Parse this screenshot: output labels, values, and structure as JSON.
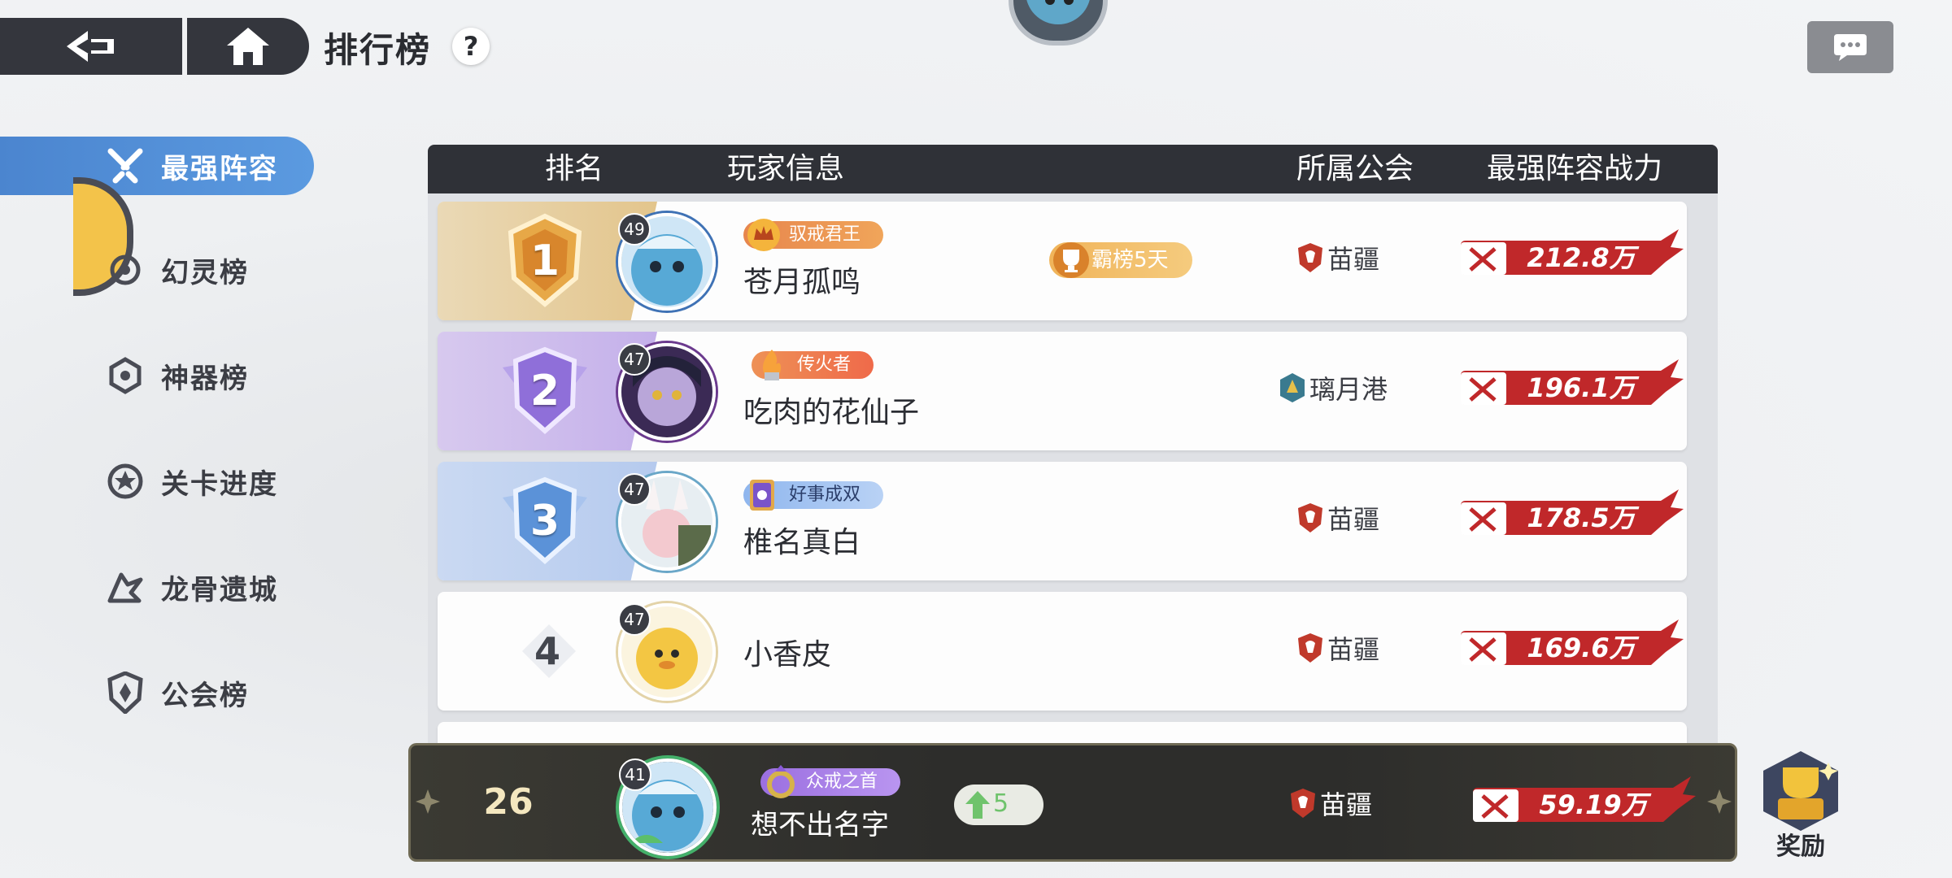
{
  "header": {
    "title": "排行榜",
    "help_label": "?"
  },
  "sidebar": {
    "items": [
      {
        "label": "最强阵容",
        "icon": "crossed-swords-icon",
        "active": true
      },
      {
        "label": "幻灵榜",
        "icon": "spirit-icon",
        "active": false
      },
      {
        "label": "神器榜",
        "icon": "artifact-icon",
        "active": false
      },
      {
        "label": "关卡进度",
        "icon": "star-badge-icon",
        "active": false
      },
      {
        "label": "龙骨遗城",
        "icon": "dragon-icon",
        "active": false
      },
      {
        "label": "公会榜",
        "icon": "guild-shield-icon",
        "active": false
      }
    ]
  },
  "table": {
    "headers": {
      "rank": "排名",
      "player": "玩家信息",
      "guild": "所属公会",
      "power": "最强阵容战力"
    },
    "rows": [
      {
        "rank": "1",
        "level": "49",
        "title": "驭戒君王",
        "name": "苍月孤鸣",
        "honor": "霸榜5天",
        "guild": "苗疆",
        "power": "212.8万"
      },
      {
        "rank": "2",
        "level": "47",
        "title": "传火者",
        "name": "吃肉的花仙子",
        "guild": "璃月港",
        "power": "196.1万"
      },
      {
        "rank": "3",
        "level": "47",
        "title": "好事成双",
        "name": "椎名真白",
        "guild": "苗疆",
        "power": "178.5万"
      },
      {
        "rank": "4",
        "level": "47",
        "name": "小香皮",
        "guild": "苗疆",
        "power": "169.6万"
      }
    ]
  },
  "my_rank": {
    "rank": "26",
    "level": "41",
    "title": "众戒之首",
    "name": "想不出名字",
    "change": "5",
    "guild": "苗疆",
    "power": "59.19万"
  },
  "reward": {
    "label": "奖励"
  },
  "colors": {
    "accent_blue": "#4b85cf",
    "power_red": "#c0282a",
    "dark_header": "#2f3137",
    "gold": "#e3c58c"
  }
}
